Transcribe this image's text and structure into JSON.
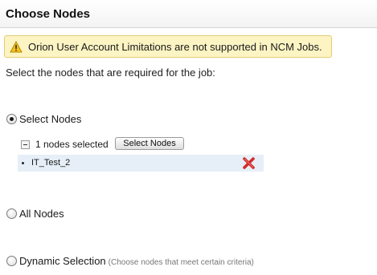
{
  "header": {
    "title": "Choose Nodes"
  },
  "warning": {
    "icon": "warning-triangle-icon",
    "text": "Orion User Account Limitations are not supported in NCM Jobs."
  },
  "instructions": "Select the nodes that are required for the job:",
  "options": {
    "select_nodes": {
      "label": "Select Nodes",
      "checked": true
    },
    "all_nodes": {
      "label": "All Nodes",
      "checked": false
    },
    "dynamic_selection": {
      "label": "Dynamic Selection",
      "hint": "(Choose nodes that meet certain criteria)",
      "checked": false
    }
  },
  "selection": {
    "count_text": "1 nodes selected",
    "button_label": "Select Nodes",
    "nodes": [
      {
        "name": "IT_Test_2"
      }
    ]
  },
  "colors": {
    "warning_bg": "#fcf4c3",
    "warning_border": "#e2cd74",
    "node_row_bg": "#e6eff7",
    "remove_icon": "#d42b2b"
  }
}
